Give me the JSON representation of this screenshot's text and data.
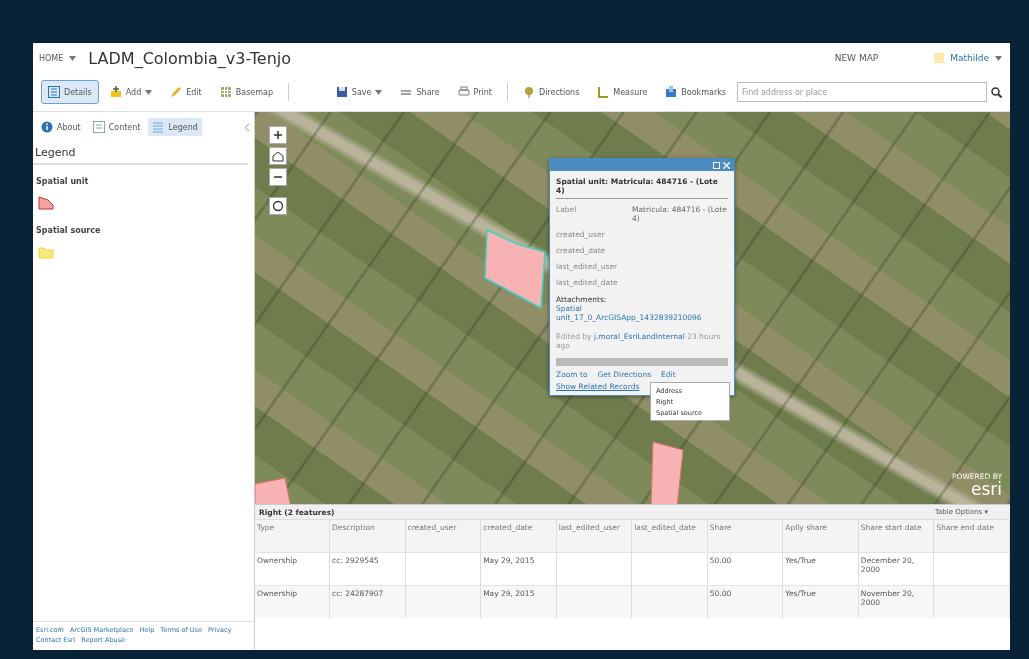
{
  "header": {
    "home": "HOME",
    "title": "LADM_Colombia_v3-Tenjo",
    "new_map": "NEW MAP",
    "user": "Mathilde"
  },
  "toolbar": {
    "left": [
      {
        "label": "Details",
        "kind": "details",
        "selected": true,
        "dropdown": false
      },
      {
        "label": "Add",
        "kind": "add",
        "selected": false,
        "dropdown": true
      },
      {
        "label": "Edit",
        "kind": "edit",
        "selected": false,
        "dropdown": false
      },
      {
        "label": "Basemap",
        "kind": "basemap",
        "selected": false,
        "dropdown": false
      }
    ],
    "right": [
      {
        "label": "Save",
        "kind": "save",
        "dropdown": true
      },
      {
        "label": "Share",
        "kind": "share",
        "dropdown": false
      },
      {
        "label": "Print",
        "kind": "print",
        "dropdown": false
      },
      {
        "label": "Directions",
        "kind": "directions",
        "dropdown": false
      },
      {
        "label": "Measure",
        "kind": "measure",
        "dropdown": false
      },
      {
        "label": "Bookmarks",
        "kind": "bookmarks",
        "dropdown": false
      }
    ],
    "search": {
      "placeholder": "Find address or place"
    }
  },
  "sidebar": {
    "tabs": [
      {
        "label": "About",
        "kind": "about",
        "selected": false
      },
      {
        "label": "Content",
        "kind": "content",
        "selected": false
      },
      {
        "label": "Legend",
        "kind": "legend",
        "selected": true
      }
    ],
    "heading": "Legend",
    "legend": [
      {
        "label": "Spatial unit",
        "kind": "polygon"
      },
      {
        "label": "Spatial source",
        "kind": "folder"
      }
    ],
    "footer_links": [
      "Esri.com",
      "ArcGIS Marketplace",
      "Help",
      "Terms of Use",
      "Privacy",
      "Contact Esri",
      "Report Abuse"
    ]
  },
  "map": {
    "popup": {
      "title": "Spatial unit: Matricula: 484716 - (Lote 4)",
      "fields": [
        {
          "name": "Label",
          "value": "Matricula: 484716 - (Lote 4)"
        },
        {
          "name": "created_user"
        },
        {
          "name": "created_date"
        },
        {
          "name": "last_edited_user"
        },
        {
          "name": "last_edited_date"
        }
      ],
      "attachments_label": "Attachments:",
      "attachment": "Spatial unit_17_0_ArcGISApp_1432839210096",
      "edited_prefix": "Edited by",
      "edited_user": "j.moral_EsriLandInternal",
      "edited_suffix": "23 hours ago",
      "actions": [
        "Zoom to",
        "Get Directions",
        "Edit"
      ],
      "related": "Show Related Records",
      "related_menu": [
        "Address",
        "Right",
        "Spatial source"
      ]
    },
    "powered_by": "POWERED BY",
    "logo": "esri"
  },
  "table": {
    "title": "Right (2 features)",
    "options": "Table Options ▾",
    "columns": [
      "Type",
      "Description",
      "created_user",
      "created_date",
      "last_edited_user",
      "last_edited_date",
      "Share",
      "Aplly share",
      "Share start date",
      "Share end date"
    ],
    "rows": [
      [
        "Ownership",
        "cc: 2929545",
        "",
        "May 29, 2015",
        "",
        "",
        "50.00",
        "Yes/True",
        "December 20, 2000",
        ""
      ],
      [
        "Ownership",
        "cc: 24287907",
        "",
        "May 29, 2015",
        "",
        "",
        "50.00",
        "Yes/True",
        "November 20, 2000",
        ""
      ]
    ]
  }
}
